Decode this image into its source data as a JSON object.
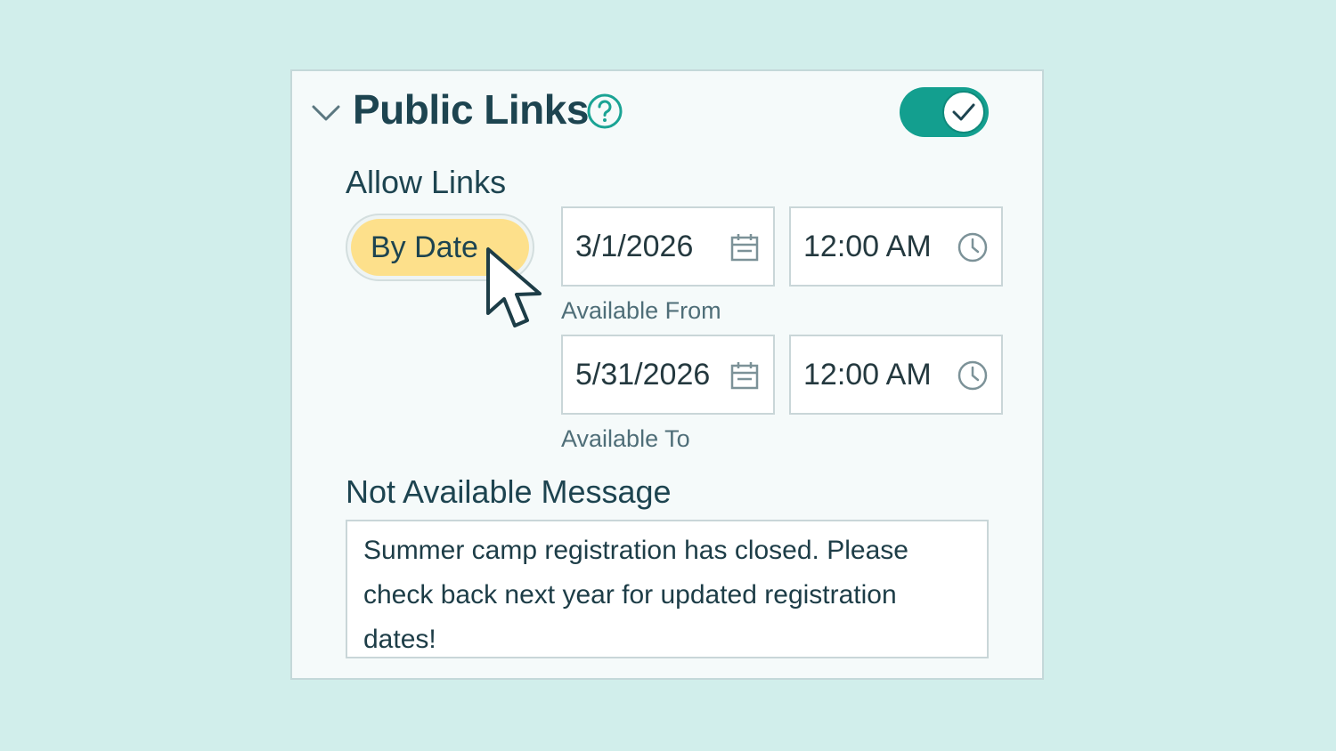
{
  "header": {
    "title": "Public Links",
    "toggle_on": true
  },
  "allow_links": {
    "label": "Allow Links",
    "mode": "By Date"
  },
  "available_from": {
    "date": "3/1/2026",
    "time": "12:00 AM",
    "label": "Available From"
  },
  "available_to": {
    "date": "5/31/2026",
    "time": "12:00 AM",
    "label": "Available To"
  },
  "message": {
    "label": "Not Available Message",
    "text": "Summer camp registration has closed. Please check back next year for updated registration dates!"
  },
  "colors": {
    "background": "#d1eeeb",
    "accent": "#139f8f",
    "pill": "#fde08b",
    "text": "#1d4450"
  },
  "icons": {
    "collapse": "chevron-down-icon",
    "help": "question-circle-icon",
    "toggle": "check-icon",
    "date": "calendar-icon",
    "time": "clock-icon",
    "pointer": "cursor-arrow-icon"
  }
}
